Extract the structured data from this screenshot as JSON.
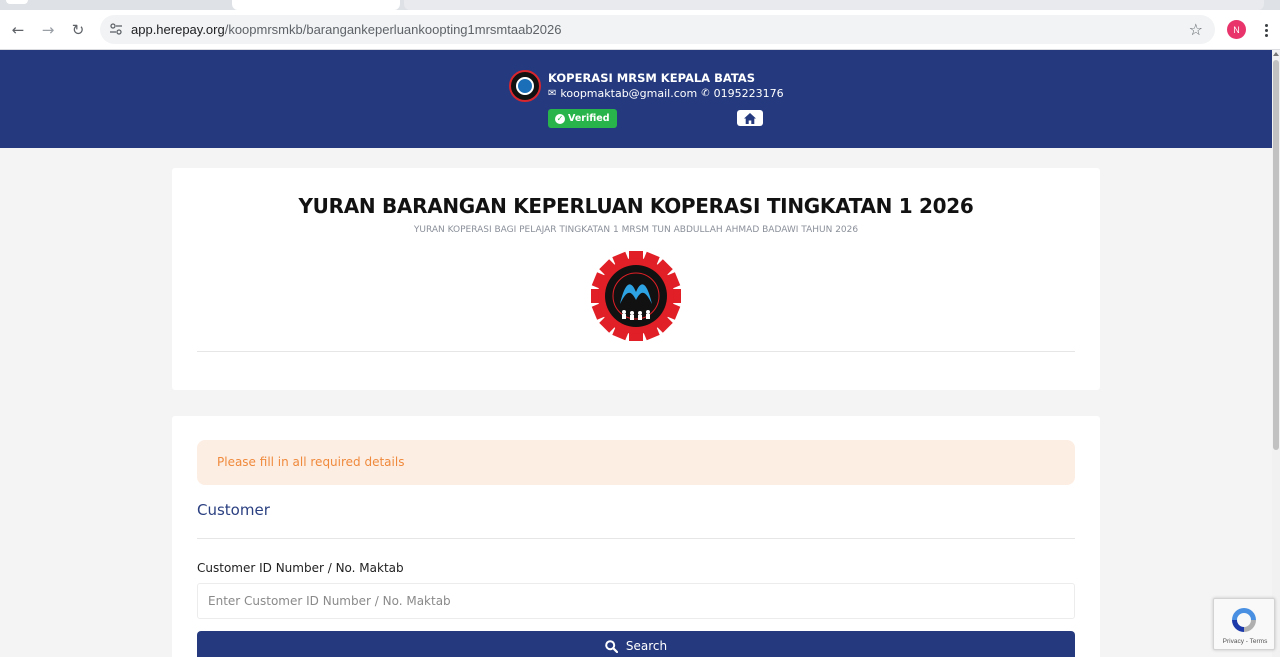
{
  "browser": {
    "url_host": "app.herepay.org",
    "url_path": "/koopmrsmkb/barangankeperluankoopting1mrsmtaab2026",
    "profile_initial": "N"
  },
  "header": {
    "org_name": "KOPERASI MRSM KEPALA BATAS",
    "email": "koopmaktab@gmail.com",
    "phone": "0195223176",
    "verified_label": "Verified"
  },
  "event": {
    "title": "YURAN BARANGAN KEPERLUAN KOPERASI TINGKATAN 1 2026",
    "subtitle": "YURAN KOPERASI BAGI PELAJAR TINGKATAN 1 MRSM TUN ABDULLAH AHMAD BADAWI TAHUN 2026"
  },
  "form": {
    "alert": "Please fill in all required details",
    "section_title": "Customer",
    "id_label": "Customer ID Number / No. Maktab",
    "id_placeholder": "Enter Customer ID Number / No. Maktab",
    "id_value": "",
    "search_label": "Search"
  },
  "recaptcha": {
    "links": "Privacy - Terms"
  },
  "colors": {
    "brand": "#253a7e",
    "verified": "#28b44a",
    "alert_bg": "#fdeee4",
    "alert_text": "#ef8a3c"
  }
}
